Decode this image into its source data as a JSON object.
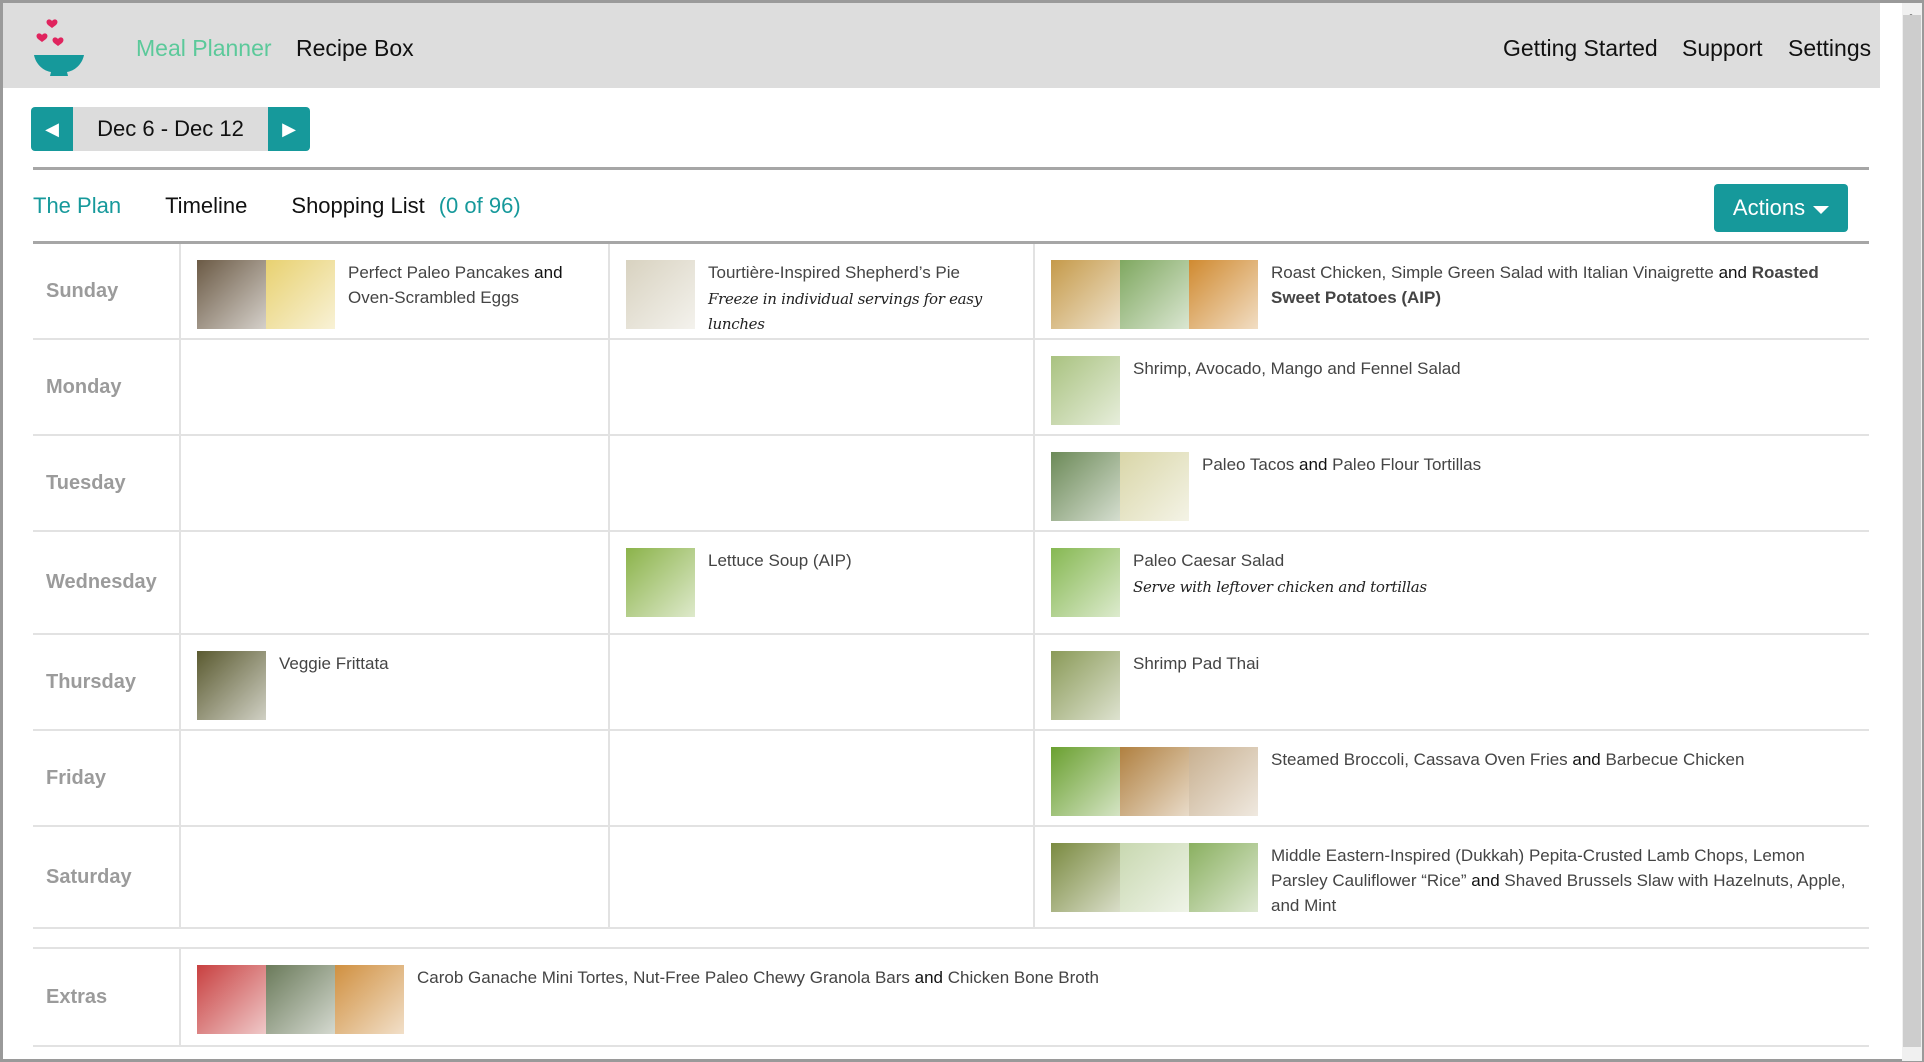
{
  "header": {
    "logo": "bowl-hearts-logo",
    "nav_left": [
      "Meal Planner",
      "Recipe Box"
    ],
    "nav_right": [
      "Getting Started",
      "Support",
      "Settings"
    ]
  },
  "week": {
    "range": "Dec 6 - Dec 12",
    "prev": "◀",
    "next": "▶"
  },
  "tabs": [
    {
      "label": "The Plan",
      "active": true
    },
    {
      "label": "Timeline"
    },
    {
      "label": "Shopping List",
      "count": "(0 of 96)"
    }
  ],
  "actions": {
    "label": "Actions"
  },
  "colors": {
    "accent": "#16999b",
    "active_nav": "#5bc99a",
    "header_bg": "#dddddd",
    "day_label": "#9b9b9b"
  },
  "days": [
    {
      "day": "Sunday",
      "col1": {
        "parts": [
          "Perfect Paleo Pancakes",
          "and",
          "Oven-Scrambled Eggs"
        ],
        "thumbs": [
          "#6b5a45",
          "#e8d170"
        ]
      },
      "col2": {
        "parts": [
          "Tourtière-Inspired Shepherd’s Pie"
        ],
        "note": "Freeze in individual servings for easy lunches",
        "thumbs": [
          "#d8d2c0"
        ]
      },
      "col3": {
        "parts": [
          "Roast Chicken, Simple Green Salad with Italian Vinaigrette",
          "and",
          "Roasted Sweet Potatoes (AIP)"
        ],
        "bold_last": true,
        "thumbs": [
          "#c59a4a",
          "#7fa860",
          "#d08a30"
        ]
      }
    },
    {
      "day": "Monday",
      "col3": {
        "parts": [
          "Shrimp, Avocado, Mango and Fennel Salad"
        ],
        "thumbs": [
          "#a9c280"
        ]
      }
    },
    {
      "day": "Tuesday",
      "col3": {
        "parts": [
          "Paleo Tacos",
          "and",
          "Paleo Flour Tortillas"
        ],
        "thumbs": [
          "#6c8a58",
          "#d9d6a8"
        ]
      }
    },
    {
      "day": "Wednesday",
      "col2": {
        "parts": [
          "Lettuce Soup (AIP)"
        ],
        "thumbs": [
          "#8bb34a"
        ]
      },
      "col3": {
        "parts": [
          "Paleo Caesar Salad"
        ],
        "note": "Serve with leftover chicken and tortillas",
        "thumbs": [
          "#86b852"
        ]
      }
    },
    {
      "day": "Thursday",
      "col1": {
        "parts": [
          "Veggie Frittata"
        ],
        "thumbs": [
          "#5a5a30"
        ]
      },
      "col3": {
        "parts": [
          "Shrimp Pad Thai"
        ],
        "thumbs": [
          "#8a9a58"
        ]
      }
    },
    {
      "day": "Friday",
      "col3": {
        "parts": [
          "Steamed Broccoli, Cassava Oven Fries",
          "and",
          "Barbecue Chicken"
        ],
        "thumbs": [
          "#6aa030",
          "#b08040",
          "#c8b090"
        ]
      }
    },
    {
      "day": "Saturday",
      "col3": {
        "parts": [
          "Middle Eastern-Inspired (Dukkah) Pepita-Crusted Lamb Chops, Lemon Parsley Cauliflower “Rice”",
          "and",
          "Shaved Brussels Slaw with Hazelnuts, Apple, and Mint"
        ],
        "thumbs": [
          "#7a8a40",
          "#c8d8b0",
          "#8ab060"
        ]
      }
    }
  ],
  "extras": {
    "label": "Extras",
    "parts": [
      "Carob Ganache Mini Tortes, Nut-Free Paleo Chewy Granola Bars",
      "and",
      "Chicken Bone Broth"
    ],
    "thumbs": [
      "#c84040",
      "#6a7a5a",
      "#d09040"
    ]
  }
}
